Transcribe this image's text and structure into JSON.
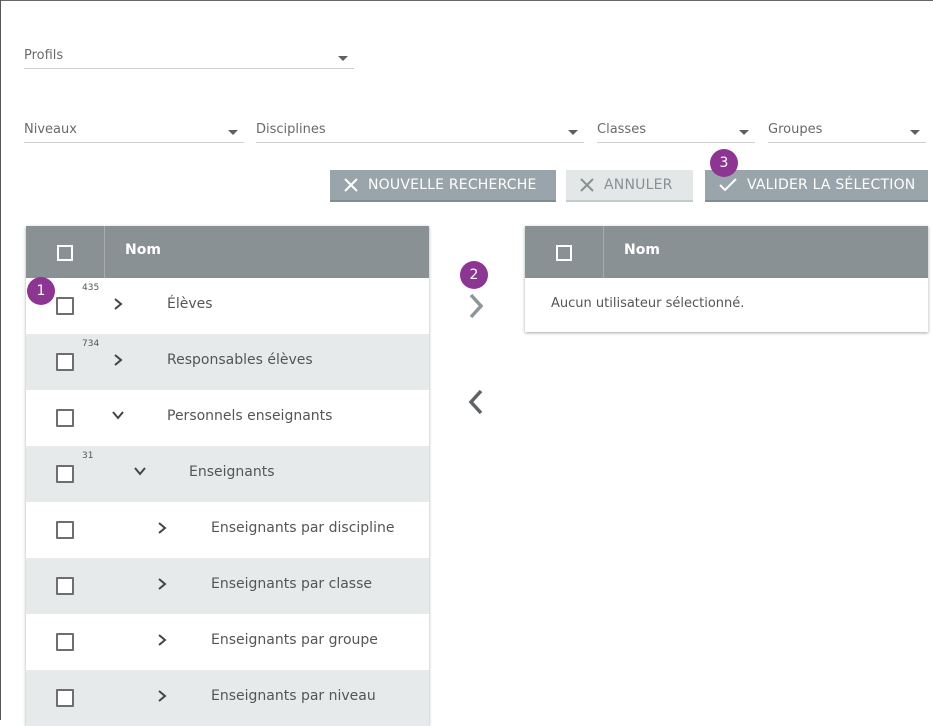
{
  "filters": {
    "profils": "Profils",
    "niveaux": "Niveaux",
    "disciplines": "Disciplines",
    "classes": "Classes",
    "groupes": "Groupes"
  },
  "toolbar": {
    "new_search": "NOUVELLE RECHERCHE",
    "cancel": "ANNULER",
    "validate": "VALIDER LA SÉLECTION"
  },
  "left_table": {
    "header": "Nom",
    "rows": [
      {
        "label": "Élèves",
        "count": "435",
        "expanded": false,
        "level": 0
      },
      {
        "label": "Responsables élèves",
        "count": "734",
        "expanded": false,
        "level": 0
      },
      {
        "label": "Personnels enseignants",
        "count": "",
        "expanded": true,
        "level": 0
      },
      {
        "label": "Enseignants",
        "count": "31",
        "expanded": true,
        "level": 1
      },
      {
        "label": "Enseignants par discipline",
        "count": "",
        "expanded": false,
        "level": 2
      },
      {
        "label": "Enseignants par classe",
        "count": "",
        "expanded": false,
        "level": 2
      },
      {
        "label": "Enseignants par groupe",
        "count": "",
        "expanded": false,
        "level": 2
      },
      {
        "label": "Enseignants par niveau",
        "count": "",
        "expanded": false,
        "level": 2
      }
    ]
  },
  "right_table": {
    "header": "Nom",
    "empty_message": "Aucun utilisateur sélectionné."
  },
  "badges": {
    "one": "1",
    "two": "2",
    "three": "3"
  },
  "colors": {
    "accent_badge": "#8c3592",
    "header_bg": "#8a9194",
    "button_bg": "#99a5aa",
    "row_alt": "#e6eaeb"
  }
}
